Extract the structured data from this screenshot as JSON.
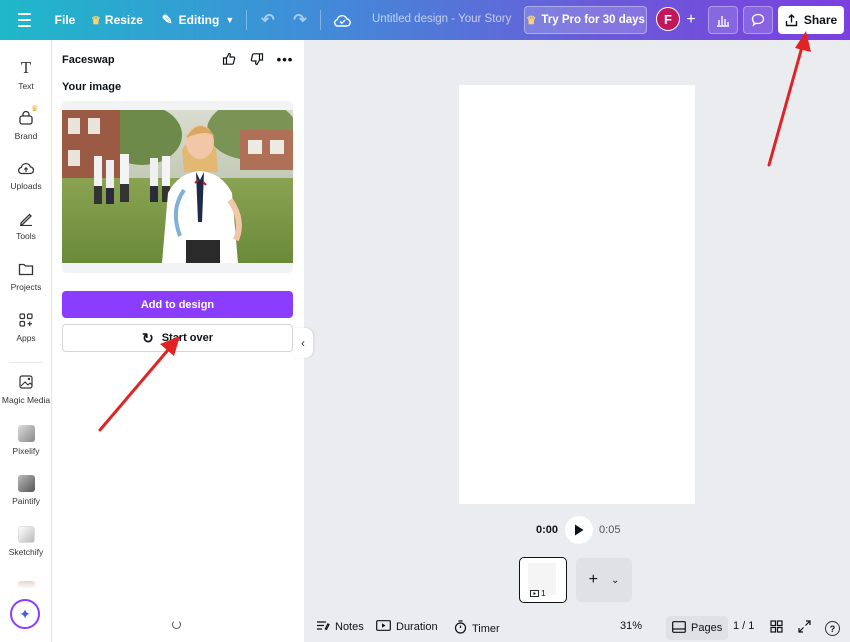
{
  "topbar": {
    "file_label": "File",
    "resize_label": "Resize",
    "editing_label": "Editing",
    "doc_title": "Untitled design - Your Story",
    "trypro_label": "Try Pro for 30 days",
    "avatar_initial": "F",
    "share_label": "Share"
  },
  "rail": {
    "items": [
      {
        "label": "Text",
        "icon": "text-icon"
      },
      {
        "label": "Brand",
        "icon": "brand-icon"
      },
      {
        "label": "Uploads",
        "icon": "uploads-icon"
      },
      {
        "label": "Tools",
        "icon": "tools-icon"
      },
      {
        "label": "Projects",
        "icon": "projects-icon"
      },
      {
        "label": "Apps",
        "icon": "apps-icon"
      },
      {
        "label": "Magic Media",
        "icon": "magic-media-icon"
      },
      {
        "label": "Pixelify",
        "icon": "pixelify-thumb"
      },
      {
        "label": "Paintify",
        "icon": "paintify-thumb"
      },
      {
        "label": "Sketchify",
        "icon": "sketchify-thumb"
      }
    ]
  },
  "panel": {
    "title": "Faceswap",
    "your_image_label": "Your image",
    "add_to_design_label": "Add to design",
    "start_over_label": "Start over"
  },
  "canvas": {
    "time_current": "0:00",
    "time_total": "0:05",
    "page_number": "1"
  },
  "bottombar": {
    "notes_label": "Notes",
    "duration_label": "Duration",
    "timer_label": "Timer",
    "zoom_level": "31%",
    "pages_label": "Pages",
    "page_count": "1 / 1"
  },
  "colors": {
    "accent": "#8b3dff",
    "arrow": "#e02424"
  }
}
